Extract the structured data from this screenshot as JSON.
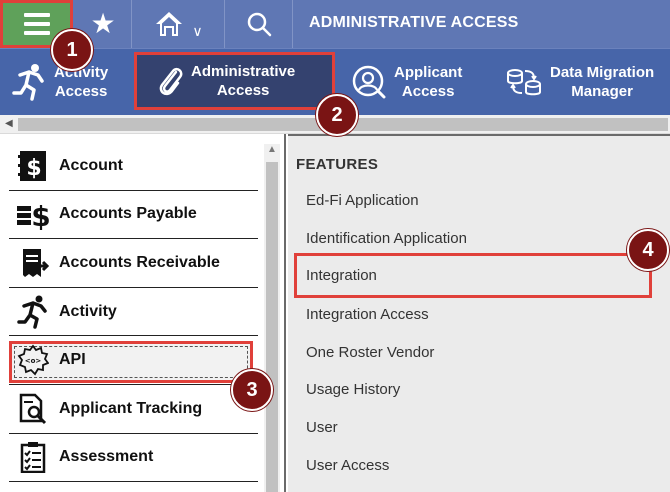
{
  "header": {
    "title": "ADMINISTRATIVE ACCESS",
    "icons": [
      "hamburger-menu-icon",
      "star-icon",
      "home-icon",
      "chevron-down-icon",
      "search-icon"
    ]
  },
  "ribbon": {
    "items": [
      {
        "line1": "Activity",
        "line2": "Access",
        "icon": "runner-icon"
      },
      {
        "line1": "Administrative",
        "line2": "Access",
        "icon": "paperclip-icon",
        "selected": true
      },
      {
        "line1": "Applicant",
        "line2": "Access",
        "icon": "person-search-icon"
      },
      {
        "line1": "Data Migration",
        "line2": "Manager",
        "icon": "database-sync-icon"
      }
    ]
  },
  "left_list": {
    "items": [
      {
        "label": "Account",
        "icon": "dollar-book-icon"
      },
      {
        "label": "Accounts Payable",
        "icon": "dollar-stack-icon"
      },
      {
        "label": "Accounts Receivable",
        "icon": "receipt-icon"
      },
      {
        "label": "Activity",
        "icon": "runner-icon"
      },
      {
        "label": "API",
        "icon": "api-gear-icon",
        "highlighted": true
      },
      {
        "label": "Applicant Tracking",
        "icon": "document-search-icon"
      },
      {
        "label": "Assessment",
        "icon": "checklist-icon"
      }
    ]
  },
  "features": {
    "heading": "FEATURES",
    "items": [
      "Ed-Fi Application",
      "Identification Application",
      "Integration",
      "Integration Access",
      "One Roster Vendor",
      "Usage History",
      "User",
      "User Access"
    ],
    "highlighted": "Integration"
  },
  "callouts": [
    "1",
    "2",
    "3",
    "4"
  ],
  "colors": {
    "topbar": "#5f77b4",
    "ribbon": "#4765a9",
    "ribbon_selected": "#34426f",
    "menu_button": "#5fa15a",
    "highlight_border": "#e0403a",
    "callout": "#7a1414",
    "features_bg": "#ebebeb"
  }
}
